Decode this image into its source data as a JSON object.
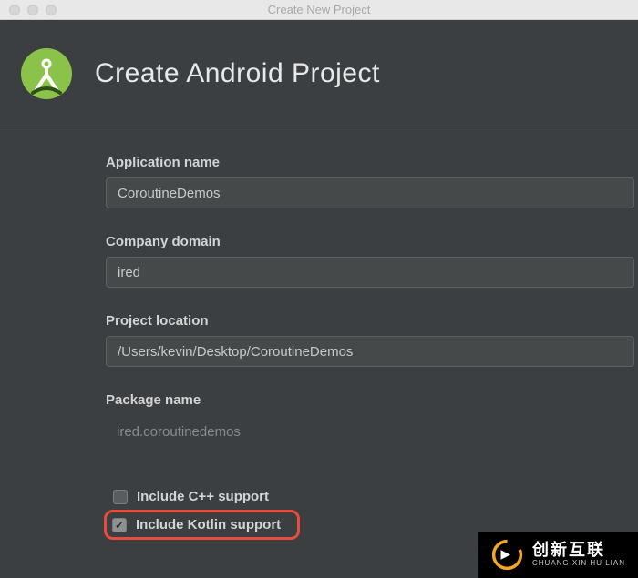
{
  "window": {
    "title": "Create New Project"
  },
  "header": {
    "title": "Create Android Project"
  },
  "fields": {
    "app_name": {
      "label": "Application name",
      "value": "CoroutineDemos"
    },
    "company_domain": {
      "label": "Company domain",
      "value": "ired"
    },
    "project_location": {
      "label": "Project location",
      "value": "/Users/kevin/Desktop/CoroutineDemos"
    },
    "package_name": {
      "label": "Package name",
      "value": "ired.coroutinedemos"
    }
  },
  "checkboxes": {
    "cpp": {
      "label": "Include C++ support",
      "checked": false
    },
    "kotlin": {
      "label": "Include Kotlin support",
      "checked": true
    }
  },
  "watermark": {
    "cn": "创新互联",
    "en": "CHUANG XIN HU LIAN"
  },
  "colors": {
    "highlight": "#e74c3c",
    "android_green": "#8bc34a"
  }
}
